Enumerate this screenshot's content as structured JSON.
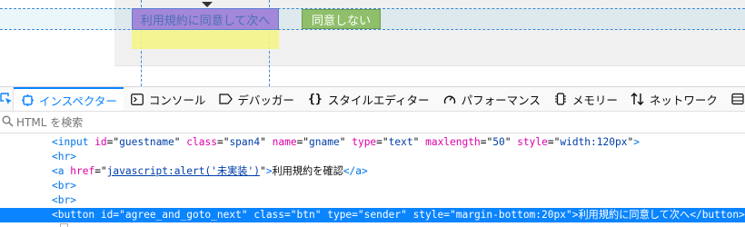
{
  "page": {
    "agree_button_label": "利用規約に同意して次へ",
    "disagree_button_label": "同意しない"
  },
  "devtools": {
    "tabs": [
      {
        "label": "インスペクター",
        "icon": "inspector-icon",
        "selected": true
      },
      {
        "label": "コンソール",
        "icon": "console-icon"
      },
      {
        "label": "デバッガー",
        "icon": "debugger-icon"
      },
      {
        "label": "スタイルエディター",
        "icon": "braces-icon"
      },
      {
        "label": "パフォーマンス",
        "icon": "gauge-icon"
      },
      {
        "label": "メモリー",
        "icon": "memory-chip-icon"
      },
      {
        "label": "ネットワーク",
        "icon": "arrows-updown-icon"
      }
    ],
    "search_placeholder": "HTML を検索",
    "markup": {
      "input_line": {
        "tag": "input",
        "attrs": [
          {
            "name": "id",
            "value": "guestname"
          },
          {
            "name": "class",
            "value": "span4"
          },
          {
            "name": "name",
            "value": "gname"
          },
          {
            "name": "type",
            "value": "text"
          },
          {
            "name": "maxlength",
            "value": "50"
          },
          {
            "name": "style",
            "value": "width:120px"
          }
        ]
      },
      "hr_line": "<hr>",
      "a_line": {
        "href": "javascript:alert('未実装')",
        "text": "利用規約を確認"
      },
      "br1": "<br>",
      "br2": "<br>",
      "button_line": {
        "attrs": [
          {
            "name": "id",
            "value": "agree_and_goto_next"
          },
          {
            "name": "class",
            "value": "btn"
          },
          {
            "name": "type",
            "value": "sender"
          },
          {
            "name": "style",
            "value": "margin-bottom:20px"
          }
        ],
        "text": "利用規約に同意して次へ"
      }
    }
  },
  "colors": {
    "highlight_content": "#a387d8",
    "highlight_margin": "#f4f587",
    "disagree_button": "#8fbf6a",
    "selection": "#0a84ff"
  }
}
